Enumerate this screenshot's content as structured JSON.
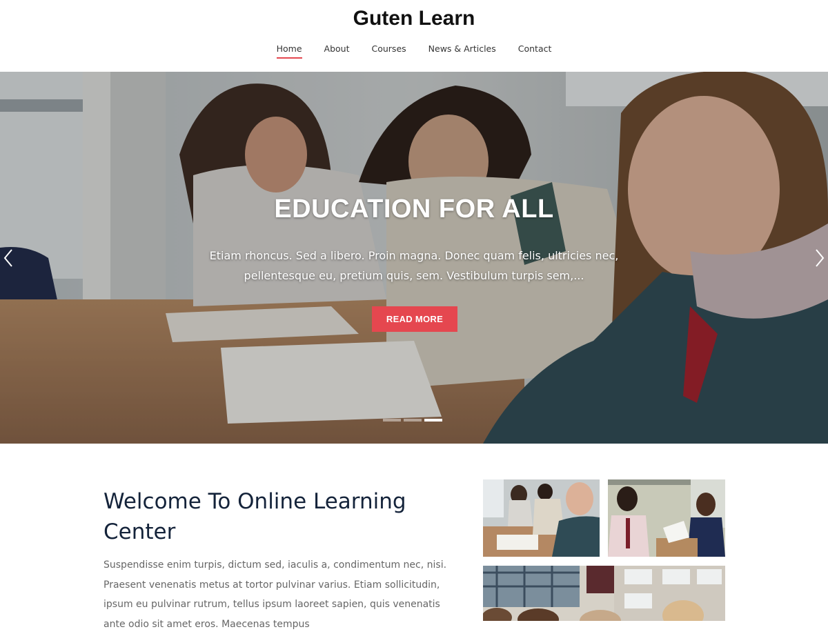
{
  "site": {
    "title": "Guten Learn"
  },
  "nav": {
    "items": [
      {
        "label": "Home",
        "active": true
      },
      {
        "label": "About"
      },
      {
        "label": "Courses"
      },
      {
        "label": "News & Articles"
      },
      {
        "label": "Contact"
      }
    ]
  },
  "hero": {
    "title": "EDUCATION FOR ALL",
    "text": "Etiam rhoncus. Sed a libero. Proin magna. Donec quam felis, ultricies nec, pellentesque eu, pretium quis, sem. Vestibulum turpis sem,...",
    "button_label": "READ MORE",
    "slide_count": 3,
    "active_slide": 3
  },
  "welcome": {
    "title": "Welcome To Online Learning Center",
    "text": "Suspendisse enim turpis, dictum sed, iaculis a, condimentum nec, nisi. Praesent venenatis metus at tortor pulvinar varius. Etiam sollicitudin, ipsum eu pulvinar rutrum, tellus ipsum laoreet sapien, quis venenatis ante odio sit amet eros. Maecenas tempus"
  },
  "icons": {
    "prev": "chevron-left-icon",
    "next": "chevron-right-icon"
  },
  "colors": {
    "accent": "#e5474f",
    "heading": "#14233a",
    "body_text": "#666666"
  }
}
